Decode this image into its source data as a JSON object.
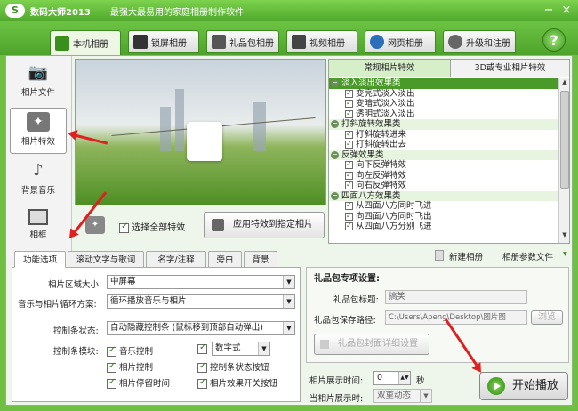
{
  "window": {
    "app_title": "数码大师2013",
    "slogan": "最强大最易用的家庭相册制作软件",
    "minimize": "−",
    "close": "×"
  },
  "top_tabs": [
    {
      "label": "本机相册",
      "icon": "photo-album-icon",
      "active": true
    },
    {
      "label": "锁屏相册",
      "icon": "monitor-icon",
      "active": false
    },
    {
      "label": "礼品包相册",
      "icon": "gift-icon",
      "active": false
    },
    {
      "label": "视频相册",
      "icon": "film-icon",
      "active": false
    },
    {
      "label": "网页相册",
      "icon": "ie-icon",
      "active": false
    },
    {
      "label": "升级和注册",
      "icon": "upgrade-icon",
      "active": false
    }
  ],
  "help": "?",
  "sidebar": [
    {
      "label": "相片文件",
      "icon": "camera-icon",
      "active": false
    },
    {
      "label": "相片特效",
      "icon": "effects-icon",
      "active": true
    },
    {
      "label": "背景音乐",
      "icon": "music-note-icon",
      "active": false
    },
    {
      "label": "相框",
      "icon": "picture-frame-icon",
      "active": false
    }
  ],
  "select_all": {
    "label": "选择全部特效",
    "checked": true
  },
  "apply_button": "应用特效到指定相片",
  "effects_panel": {
    "tabs": [
      "常规相片特效",
      "3D或专业相片特效"
    ],
    "items": [
      {
        "type": "category",
        "label": "淡入淡出效果类",
        "selected": true
      },
      {
        "type": "item",
        "label": "变亮式淡入淡出",
        "checked": true
      },
      {
        "type": "item",
        "label": "变暗式淡入淡出",
        "checked": true
      },
      {
        "type": "item",
        "label": "透明式淡入淡出",
        "checked": true
      },
      {
        "type": "category",
        "label": "打斜旋转效果类",
        "selected": false
      },
      {
        "type": "item",
        "label": "打斜旋转进来",
        "checked": true
      },
      {
        "type": "item",
        "label": "打斜旋转出去",
        "checked": true
      },
      {
        "type": "category",
        "label": "反弹效果类",
        "selected": false
      },
      {
        "type": "item",
        "label": "向下反弹特效",
        "checked": true
      },
      {
        "type": "item",
        "label": "向左反弹特效",
        "checked": true
      },
      {
        "type": "item",
        "label": "向右反弹特效",
        "checked": true
      },
      {
        "type": "category",
        "label": "四面八方效果类",
        "selected": false
      },
      {
        "type": "item",
        "label": "从四面八方同时飞进",
        "checked": true
      },
      {
        "type": "item",
        "label": "向四面八方同时飞出",
        "checked": true
      },
      {
        "type": "item",
        "label": "从四面八方分别飞进",
        "checked": true
      }
    ]
  },
  "toolbar2": {
    "new_album": "新建相册",
    "album_params": "相册参数文件"
  },
  "options_panel": {
    "tabs": [
      "功能选项",
      "滚动文字与歌词",
      "名字/注释",
      "旁白",
      "背景"
    ],
    "photo_area_label": "相片区域大小:",
    "photo_area_value": "中屏幕",
    "loop_label": "音乐与相片循环方案:",
    "loop_value": "循环播放音乐与相片",
    "ctrlbar_state_label": "控制条状态:",
    "ctrlbar_state_value": "自动隐藏控制条 (鼠标移到顶部自动弹出)",
    "ctrlbar_modules_label": "控制条模块:",
    "modules": [
      {
        "label": "音乐控制",
        "checked": true
      },
      {
        "label": "数字式",
        "checked": true,
        "dropdown": true
      },
      {
        "label": "相片控制",
        "checked": true
      },
      {
        "label": "控制条状态按钮",
        "checked": true
      },
      {
        "label": "相片停留时间",
        "checked": true
      },
      {
        "label": "相片效果开关按钮",
        "checked": true
      }
    ]
  },
  "gift_settings": {
    "title": "礼品包专项设置:",
    "gift_title_label": "礼品包标题:",
    "gift_title_value": "搞笑",
    "save_path_label": "礼品包保存路径:",
    "save_path_value": "C:\\Users\\Apeng\\Desktop\\图片图",
    "browse": "浏览",
    "cover_settings_button": "礼品包封面详细设置"
  },
  "display_time": {
    "label": "相片展示时间:",
    "value": "0",
    "unit": "秒",
    "mode_label": "当相片展示时:",
    "mode_value": "双重动态"
  },
  "start_button": "开始播放",
  "colors": {
    "brand_green": "#4fa82b",
    "arrow_red": "#e02020"
  }
}
